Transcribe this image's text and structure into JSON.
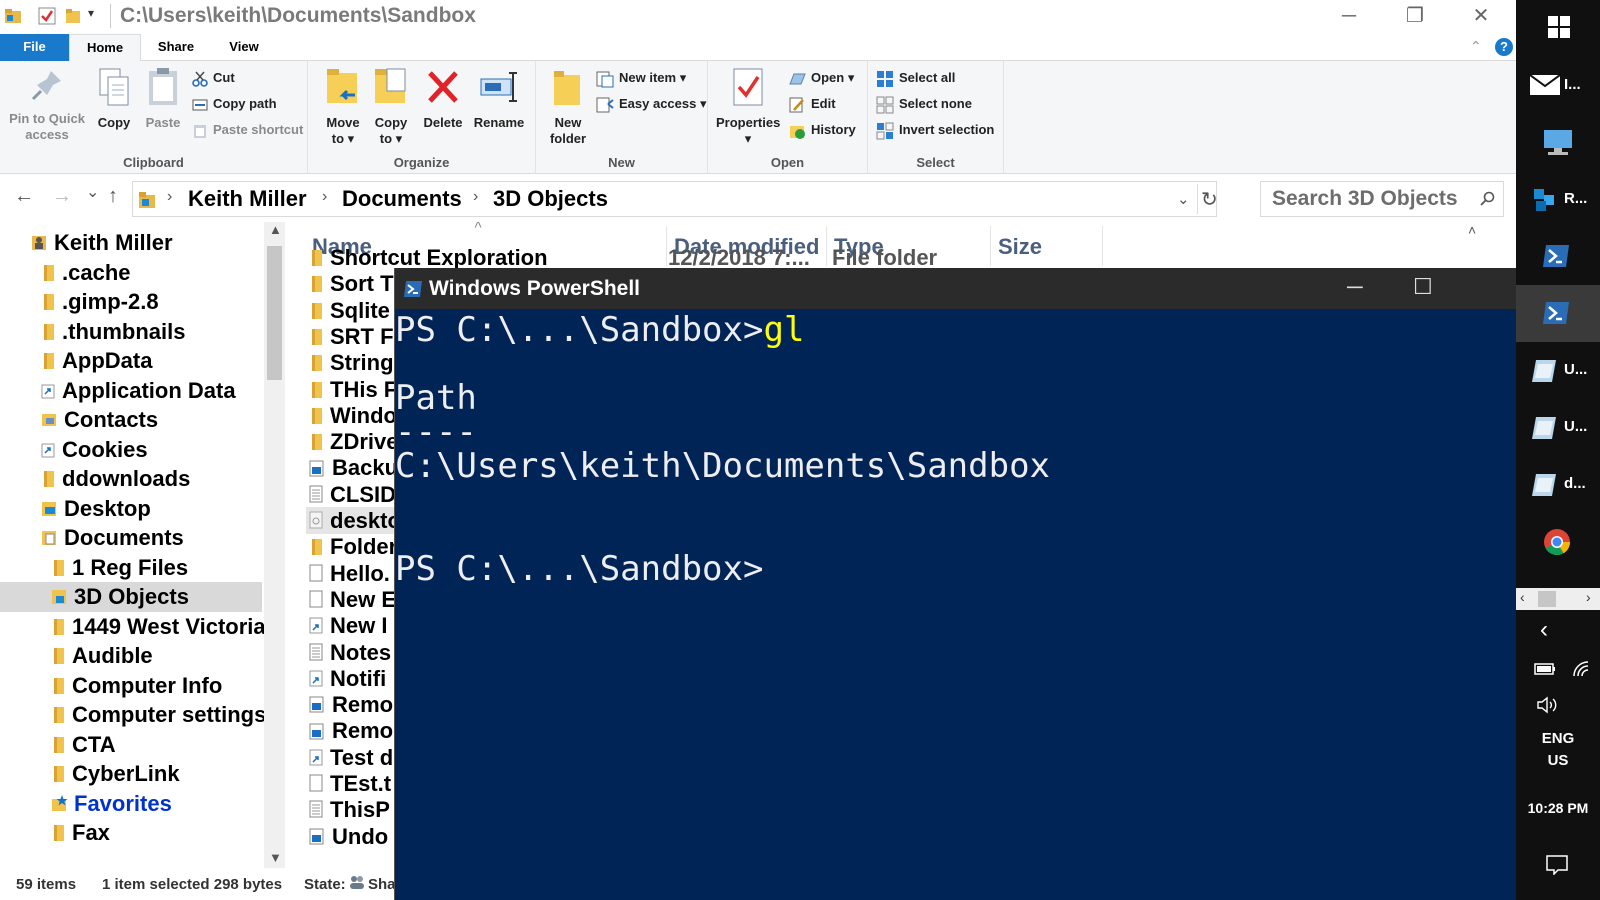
{
  "window": {
    "title_path": "C:\\Users\\keith\\Documents\\Sandbox",
    "minimize": "─",
    "restore": "❐",
    "close": "✕"
  },
  "ribbon": {
    "tabs": {
      "file": "File",
      "home": "Home",
      "share": "Share",
      "view": "View"
    },
    "collapse": "⌃",
    "help": "?",
    "clipboard": {
      "label": "Clipboard",
      "pin_line1": "Pin to Quick",
      "pin_line2": "access",
      "copy": "Copy",
      "paste": "Paste",
      "cut": "Cut",
      "copy_path": "Copy path",
      "paste_shortcut": "Paste shortcut"
    },
    "organize": {
      "label": "Organize",
      "move_line1": "Move",
      "move_line2": "to",
      "copy_line1": "Copy",
      "copy_line2": "to",
      "delete": "Delete",
      "rename": "Rename"
    },
    "new": {
      "label": "New",
      "folder_line1": "New",
      "folder_line2": "folder",
      "new_item": "New item",
      "easy_access": "Easy access"
    },
    "open": {
      "label": "Open",
      "properties": "Properties",
      "open": "Open",
      "edit": "Edit",
      "history": "History"
    },
    "select": {
      "label": "Select",
      "select_all": "Select all",
      "select_none": "Select none",
      "invert": "Invert selection"
    }
  },
  "nav": {
    "back": "←",
    "forward": "→",
    "recent": "⌄",
    "up": "↑",
    "breadcrumb": [
      "Keith Miller",
      "Documents",
      "3D Objects"
    ],
    "refresh": "↻",
    "search_placeholder": "Search 3D Objects"
  },
  "tree": [
    {
      "label": "Keith Miller",
      "icon": "user-folder-icon"
    },
    {
      "label": ".cache",
      "icon": "folder-icon"
    },
    {
      "label": ".gimp-2.8",
      "icon": "folder-icon"
    },
    {
      "label": ".thumbnails",
      "icon": "folder-icon"
    },
    {
      "label": "AppData",
      "icon": "folder-icon"
    },
    {
      "label": "Application Data",
      "icon": "shortcut-icon"
    },
    {
      "label": "Contacts",
      "icon": "contacts-icon"
    },
    {
      "label": "Cookies",
      "icon": "shortcut-icon"
    },
    {
      "label": "ddownloads",
      "icon": "folder-icon"
    },
    {
      "label": "Desktop",
      "icon": "desktop-icon"
    },
    {
      "label": "Documents",
      "icon": "documents-icon"
    },
    {
      "label": "1 Reg Files",
      "icon": "folder-icon"
    },
    {
      "label": "3D Objects",
      "icon": "3d-objects-icon"
    },
    {
      "label": "1449 West Victoria",
      "icon": "folder-icon"
    },
    {
      "label": "Audible",
      "icon": "folder-icon"
    },
    {
      "label": "Computer Info",
      "icon": "folder-icon"
    },
    {
      "label": "Computer settings",
      "icon": "folder-icon"
    },
    {
      "label": "CTA",
      "icon": "folder-icon"
    },
    {
      "label": "CyberLink",
      "icon": "folder-icon"
    },
    {
      "label": "Favorites",
      "icon": "favorites-icon"
    },
    {
      "label": "Fax",
      "icon": "folder-icon"
    }
  ],
  "columns": {
    "name": "Name",
    "date": "Date modified",
    "type": "Type",
    "size": "Size"
  },
  "files": [
    {
      "name": "Shortcut Exploration",
      "date": "12/2/2018 7:...",
      "type": "File folder"
    },
    {
      "name": "Sort T"
    },
    {
      "name": "Sqlite"
    },
    {
      "name": "SRT Fi"
    },
    {
      "name": "String"
    },
    {
      "name": "THis F"
    },
    {
      "name": "Windo"
    },
    {
      "name": "ZDrive"
    },
    {
      "name": "Backu"
    },
    {
      "name": "CLSID"
    },
    {
      "name": "deskto"
    },
    {
      "name": "Folder"
    },
    {
      "name": "Hello."
    },
    {
      "name": "New E"
    },
    {
      "name": "New I"
    },
    {
      "name": "Notes"
    },
    {
      "name": "Notifi"
    },
    {
      "name": "Remo"
    },
    {
      "name": "Remo"
    },
    {
      "name": "Test d"
    },
    {
      "name": "TEst.t"
    },
    {
      "name": "ThisP"
    },
    {
      "name": "Undo"
    }
  ],
  "status": {
    "items": "59 items",
    "selected": "1 item selected  298 bytes",
    "state": "State:",
    "state_value": "Sha"
  },
  "powershell": {
    "title": "Windows PowerShell",
    "prompt1": "PS C:\\...\\Sandbox>",
    "command": "gl",
    "header": "Path",
    "underline": "----",
    "result": "C:\\Users\\keith\\Documents\\Sandbox",
    "prompt2": "PS C:\\...\\Sandbox>",
    "minimize": "─",
    "maximize": "☐"
  },
  "taskbar": {
    "items": [
      "I...",
      "",
      "R...",
      "",
      "",
      "U...",
      "U...",
      "d...",
      ""
    ],
    "lang": "ENG",
    "region": "US",
    "time": "10:28 PM"
  }
}
